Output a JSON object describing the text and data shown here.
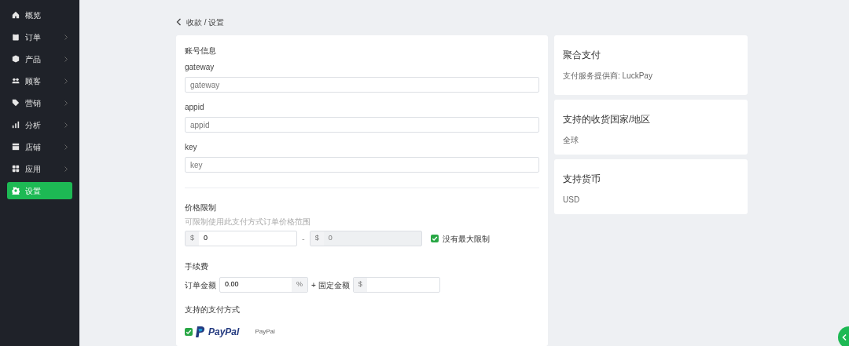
{
  "sidebar": {
    "items": [
      {
        "label": "概览",
        "expandable": false,
        "selected": false
      },
      {
        "label": "订单",
        "expandable": true,
        "selected": false
      },
      {
        "label": "产品",
        "expandable": true,
        "selected": false
      },
      {
        "label": "顾客",
        "expandable": true,
        "selected": false
      },
      {
        "label": "营销",
        "expandable": true,
        "selected": false
      },
      {
        "label": "分析",
        "expandable": true,
        "selected": false
      },
      {
        "label": "店铺",
        "expandable": true,
        "selected": false
      },
      {
        "label": "应用",
        "expandable": true,
        "selected": false
      },
      {
        "label": "设置",
        "expandable": false,
        "selected": true
      }
    ]
  },
  "breadcrumb": "收款 / 设置",
  "account": {
    "title": "账号信息",
    "fields": [
      {
        "label": "gateway",
        "placeholder": "gateway"
      },
      {
        "label": "appid",
        "placeholder": "appid"
      },
      {
        "label": "key",
        "placeholder": "key"
      }
    ]
  },
  "price_limit": {
    "title": "价格限制",
    "hint": "可限制使用此支付方式订单价格范围",
    "min": {
      "prefix": "$",
      "value": "0"
    },
    "separator": "-",
    "max": {
      "prefix": "$",
      "placeholder": "0",
      "disabled": true
    },
    "no_max": {
      "label": "没有最大限制",
      "checked": true
    }
  },
  "fee": {
    "title": "手续费",
    "order_label": "订单金额",
    "percent": {
      "value": "0.00",
      "suffix": "%"
    },
    "plus_label": "+ 固定金额",
    "fixed": {
      "prefix": "$"
    }
  },
  "methods": {
    "title": "支持的支付方式",
    "items": [
      {
        "logo_text": "PayPal",
        "name": "PayPal",
        "checked": true
      }
    ]
  },
  "info_cards": [
    {
      "title": "聚合支付",
      "text": "支付服务提供商: LuckPay"
    },
    {
      "title": "支持的收货国家/地区",
      "text": "全球"
    },
    {
      "title": "支持货币",
      "text": "USD"
    }
  ]
}
